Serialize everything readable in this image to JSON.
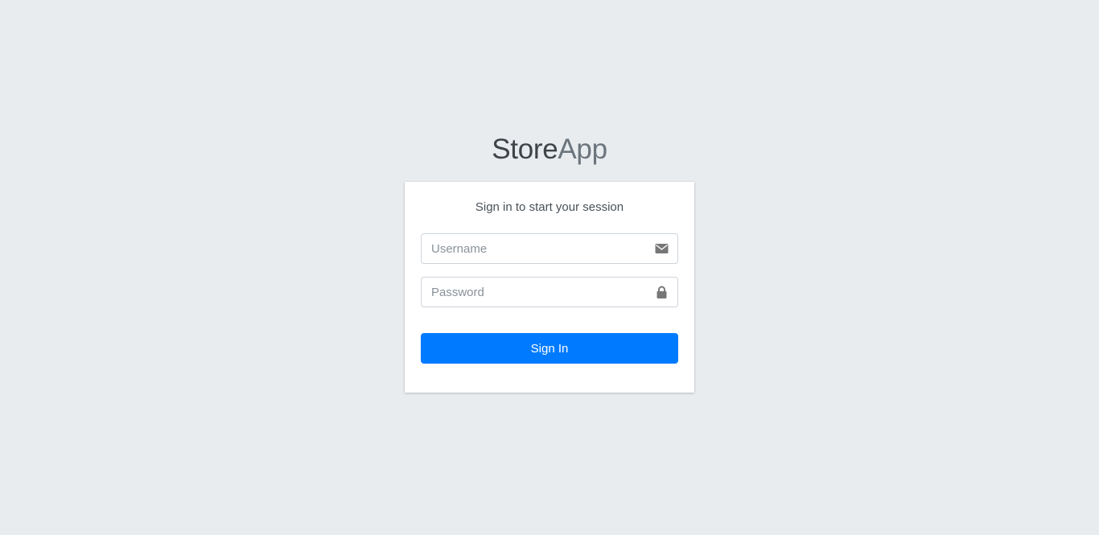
{
  "app": {
    "logo_strong": "Store",
    "logo_light": "App"
  },
  "login": {
    "message": "Sign in to start your session",
    "username": {
      "placeholder": "Username",
      "value": "",
      "icon": "envelope-icon"
    },
    "password": {
      "placeholder": "Password",
      "value": "",
      "icon": "lock-icon"
    },
    "submit_label": "Sign In"
  },
  "colors": {
    "background": "#e9ecef",
    "primary": "#007bff",
    "card": "#ffffff",
    "icon": "#777777"
  }
}
